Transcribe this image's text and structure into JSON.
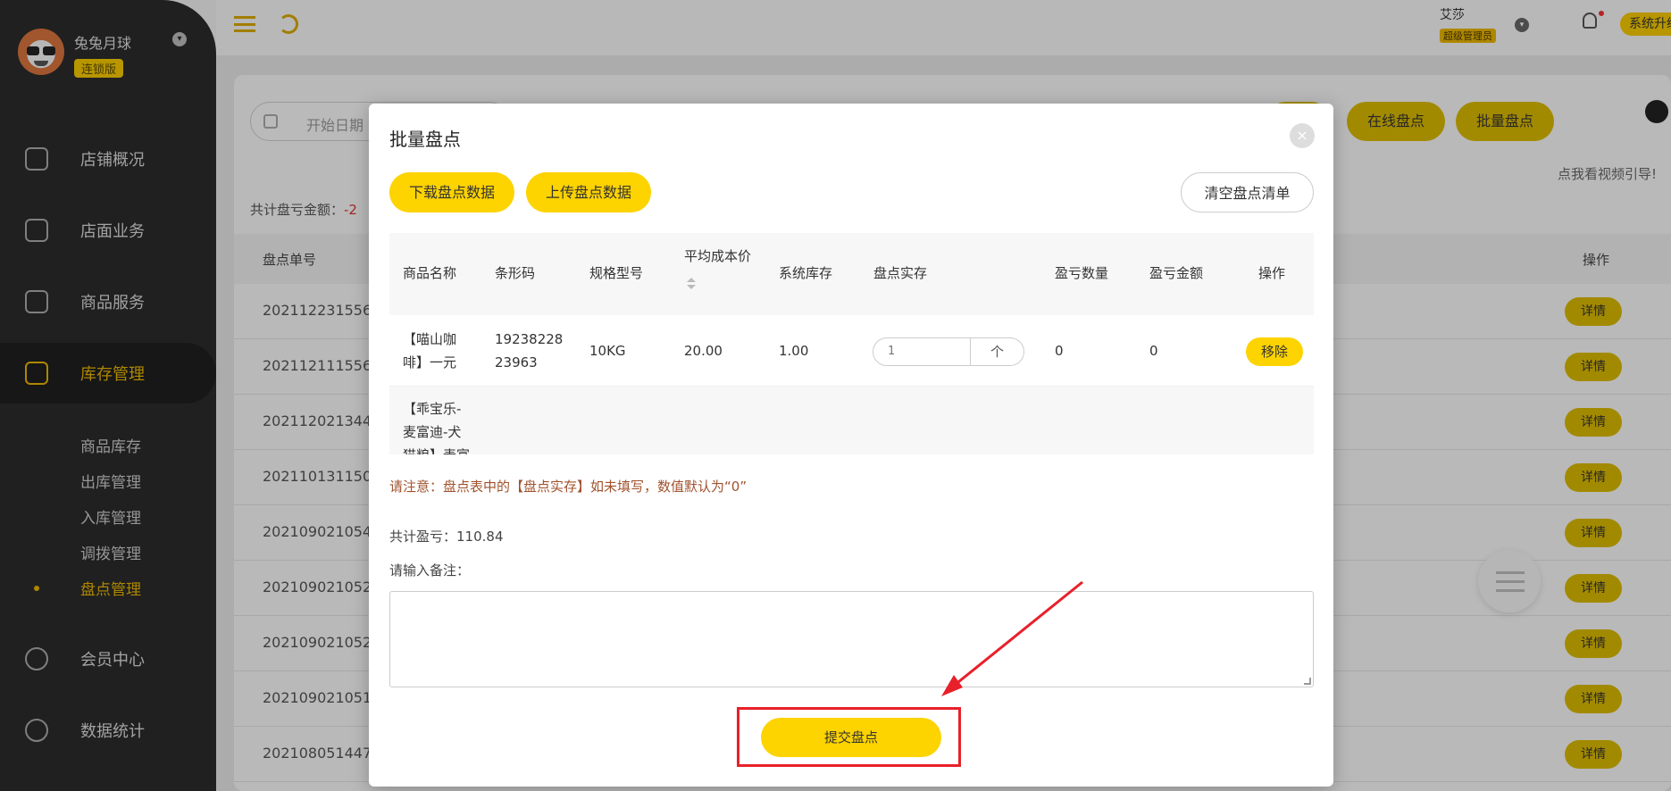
{
  "sidebar": {
    "store_name": "兔兔月球",
    "store_badge": "连锁版",
    "nav": [
      "店铺概况",
      "店面业务",
      "商品服务",
      "库存管理",
      "会员中心",
      "数据统计"
    ],
    "sub": [
      "商品库存",
      "出库管理",
      "入库管理",
      "调拨管理",
      "盘点管理"
    ]
  },
  "topbar": {
    "user_name": "艾莎",
    "user_role": "超级管理员",
    "upgrade": "系统升级"
  },
  "background": {
    "date_placeholder": "开始日期",
    "buttons": [
      "在线盘点",
      "批量盘点"
    ],
    "video_hint": "点我看视频引导!",
    "total_loss_label": "共计盘亏金额：",
    "total_loss_value": "-2",
    "col_order_no": "盘点单号",
    "col_action": "操作",
    "rows": [
      "202112231556",
      "202112111556",
      "202112021344",
      "202110131150",
      "202109021054",
      "202109021052",
      "202109021052",
      "202109021051",
      "202108051447"
    ],
    "detail_label": "详情"
  },
  "modal": {
    "title": "批量盘点",
    "close": "×",
    "download": "下载盘点数据",
    "upload": "上传盘点数据",
    "clear": "清空盘点清单",
    "headers": {
      "name": "商品名称",
      "barcode": "条形码",
      "spec": "规格型号",
      "avg_cost": "平均成本价",
      "stock": "系统库存",
      "actual": "盘点实存",
      "loss_qty": "盈亏数量",
      "loss_amt": "盈亏金额",
      "action": "操作"
    },
    "rows": [
      {
        "name_l1": "【喵山咖",
        "name_l2": "啡】一元",
        "barcode_l1": "19238228",
        "barcode_l2": "23963",
        "spec": "10KG",
        "avg_cost": "20.00",
        "stock": "1.00",
        "actual": "1",
        "actual_btn": "个",
        "loss_qty": "0",
        "loss_amt": "0",
        "action": "移除"
      },
      {
        "name_l1": "【乖宝乐-",
        "name_l2": "麦富迪-犬",
        "name_l3": "猫粮】麦富"
      }
    ],
    "notice": "请注意：盘点表中的【盘点实存】如未填写，数值默认为“0”",
    "sum_label": "共计盈亏：",
    "sum_value": "110.84",
    "remark_label": "请输入备注：",
    "submit": "提交盘点"
  }
}
